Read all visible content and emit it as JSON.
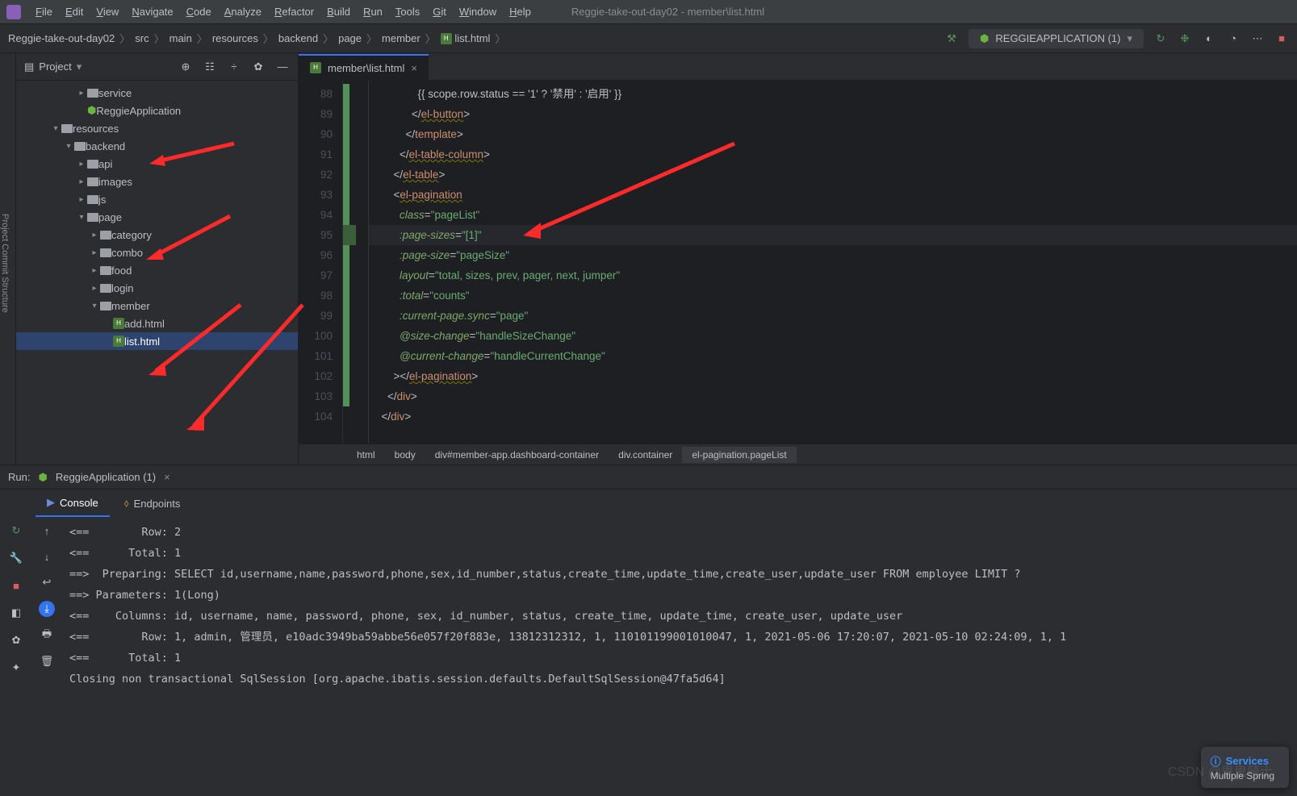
{
  "menubar": {
    "items": [
      "File",
      "Edit",
      "View",
      "Navigate",
      "Code",
      "Analyze",
      "Refactor",
      "Build",
      "Run",
      "Tools",
      "Git",
      "Window",
      "Help"
    ],
    "title": "Reggie-take-out-day02 - member\\list.html"
  },
  "breadcrumbs": [
    "Reggie-take-out-day02",
    "src",
    "main",
    "resources",
    "backend",
    "page",
    "member",
    "list.html"
  ],
  "runConfig": "REGGIEAPPLICATION (1)",
  "projectPanel": {
    "title": "Project",
    "tree": [
      {
        "indent": 4,
        "arrow": ">",
        "icon": "folder",
        "label": "service"
      },
      {
        "indent": 4,
        "arrow": "",
        "icon": "spring",
        "label": "ReggieApplication"
      },
      {
        "indent": 2,
        "arrow": "v",
        "icon": "res",
        "label": "resources"
      },
      {
        "indent": 3,
        "arrow": "v",
        "icon": "folder",
        "label": "backend"
      },
      {
        "indent": 4,
        "arrow": ">",
        "icon": "folder",
        "label": "api"
      },
      {
        "indent": 4,
        "arrow": ">",
        "icon": "folder",
        "label": "images"
      },
      {
        "indent": 4,
        "arrow": ">",
        "icon": "folder",
        "label": "js"
      },
      {
        "indent": 4,
        "arrow": "v",
        "icon": "folder",
        "label": "page"
      },
      {
        "indent": 5,
        "arrow": ">",
        "icon": "folder",
        "label": "category"
      },
      {
        "indent": 5,
        "arrow": ">",
        "icon": "folder",
        "label": "combo"
      },
      {
        "indent": 5,
        "arrow": ">",
        "icon": "folder",
        "label": "food"
      },
      {
        "indent": 5,
        "arrow": ">",
        "icon": "folder",
        "label": "login"
      },
      {
        "indent": 5,
        "arrow": "v",
        "icon": "folder",
        "label": "member"
      },
      {
        "indent": 6,
        "arrow": "",
        "icon": "html",
        "label": "add.html"
      },
      {
        "indent": 6,
        "arrow": "",
        "icon": "html",
        "label": "list.html",
        "selected": true
      }
    ]
  },
  "editor": {
    "tabLabel": "member\\list.html",
    "lines": [
      {
        "n": 88,
        "html": "              <span class='k-text'>{{ scope.row.status == '1' ? '禁用' : '启用' }}</span>"
      },
      {
        "n": 89,
        "html": "            <span class='k-punc'>&lt;/</span><span class='k-tag wavy'>el-button</span><span class='k-punc'>&gt;</span>"
      },
      {
        "n": 90,
        "html": "          <span class='k-punc'>&lt;/</span><span class='k-tag'>template</span><span class='k-punc'>&gt;</span>"
      },
      {
        "n": 91,
        "html": "        <span class='k-punc'>&lt;/</span><span class='k-tag wavy'>el-table-column</span><span class='k-punc'>&gt;</span>"
      },
      {
        "n": 92,
        "html": "      <span class='k-punc'>&lt;/</span><span class='k-tag wavy'>el-table</span><span class='k-punc'>&gt;</span>"
      },
      {
        "n": 93,
        "html": "      <span class='k-punc'>&lt;</span><span class='k-tag wavy'>el-pagination</span>"
      },
      {
        "n": 94,
        "html": "        <span class='k-attr'>class</span><span class='k-punc'>=</span><span class='k-str'>\"pageList\"</span>"
      },
      {
        "n": 95,
        "hl": true,
        "html": "        <span class='k-attr'>:page-sizes</span><span class='k-punc'>=</span><span class='k-str'>\"[1]\"</span>"
      },
      {
        "n": 96,
        "html": "        <span class='k-attr'>:page-size</span><span class='k-punc'>=</span><span class='k-str'>\"pageSize\"</span>"
      },
      {
        "n": 97,
        "html": "        <span class='k-attr'>layout</span><span class='k-punc'>=</span><span class='k-str'>\"total, sizes, prev, pager, next, jumper\"</span>"
      },
      {
        "n": 98,
        "html": "        <span class='k-attr'>:total</span><span class='k-punc'>=</span><span class='k-str'>\"counts\"</span>"
      },
      {
        "n": 99,
        "html": "        <span class='k-attr'>:current-page.sync</span><span class='k-punc'>=</span><span class='k-str'>\"page\"</span>"
      },
      {
        "n": 100,
        "html": "        <span class='k-attr'>@size-change</span><span class='k-punc'>=</span><span class='k-str'>\"handleSizeChange\"</span>"
      },
      {
        "n": 101,
        "html": "        <span class='k-attr'>@current-change</span><span class='k-punc'>=</span><span class='k-str'>\"handleCurrentChange\"</span>"
      },
      {
        "n": 102,
        "html": "      <span class='k-punc'>&gt;&lt;/</span><span class='k-tag wavy'>el-pagination</span><span class='k-punc'>&gt;</span>"
      },
      {
        "n": 103,
        "html": "    <span class='k-punc'>&lt;/</span><span class='k-tag'>div</span><span class='k-punc'>&gt;</span>"
      },
      {
        "n": 104,
        "html": "  <span class='k-punc'>&lt;/</span><span class='k-tag'>div</span><span class='k-punc'>&gt;</span>"
      }
    ],
    "crumbBar": [
      "html",
      "body",
      "div#member-app.dashboard-container",
      "div.container",
      "el-pagination.pageList"
    ]
  },
  "runPanel": {
    "label": "Run:",
    "config": "ReggieApplication (1)",
    "tabs": {
      "console": "Console",
      "endpoints": "Endpoints"
    },
    "console": "<==        Row: 2\n<==      Total: 1\n==>  Preparing: SELECT id,username,name,password,phone,sex,id_number,status,create_time,update_time,create_user,update_user FROM employee LIMIT ?\n==> Parameters: 1(Long)\n<==    Columns: id, username, name, password, phone, sex, id_number, status, create_time, update_time, create_user, update_user\n<==        Row: 1, admin, 管理员, e10adc3949ba59abbe56e057f20f883e, 13812312312, 1, 110101199001010047, 1, 2021-05-06 17:20:07, 2021-05-10 02:24:09, 1, 1\n<==      Total: 1\nClosing non transactional SqlSession [org.apache.ibatis.session.defaults.DefaultSqlSession@47fa5d64]"
  },
  "services": {
    "title": "Services",
    "body": "Multiple Spring"
  },
  "watermark": "CSDN @鬼鬼骑士"
}
